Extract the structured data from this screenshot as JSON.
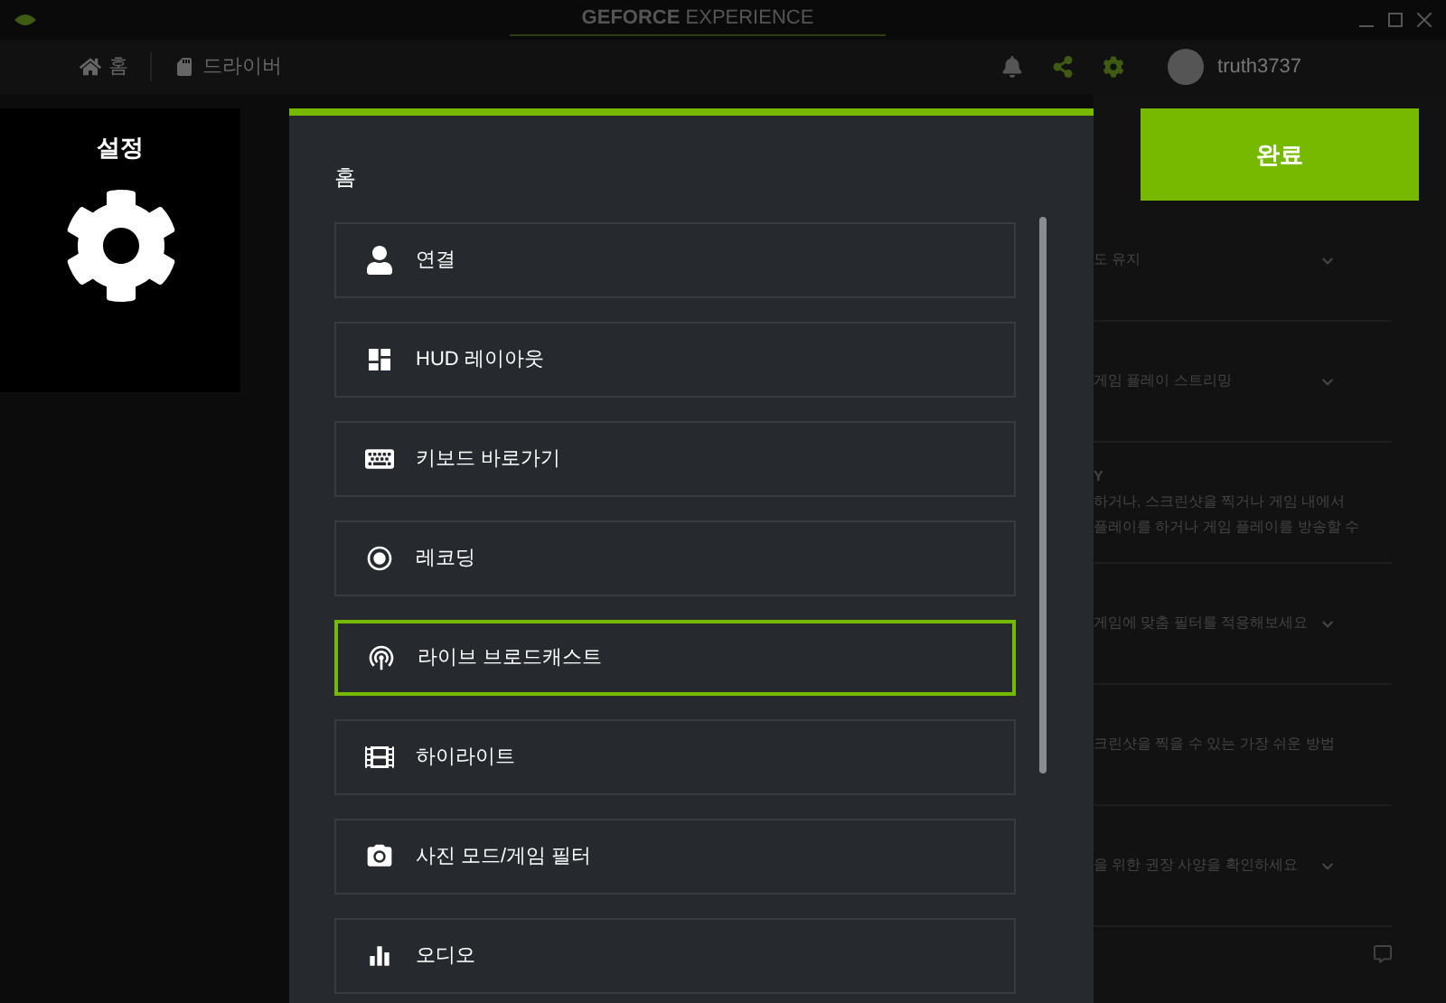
{
  "window": {
    "title_bold": "GEFORCE",
    "title_light": "EXPERIENCE"
  },
  "nav": [
    {
      "label": "홈",
      "kind": "home"
    },
    {
      "label": "드라이버",
      "kind": "driver"
    }
  ],
  "user": {
    "name": "truth3737"
  },
  "settings_tile": {
    "label": "설정"
  },
  "done_button": {
    "label": "완료"
  },
  "panel": {
    "heading": "홈",
    "items": [
      {
        "label": "연결",
        "kind": "person",
        "selected": false
      },
      {
        "label": "HUD 레이아웃",
        "kind": "layout",
        "selected": false
      },
      {
        "label": "키보드 바로가기",
        "kind": "keyboard",
        "selected": false
      },
      {
        "label": "레코딩",
        "kind": "record",
        "selected": false
      },
      {
        "label": "라이브 브로드캐스트",
        "kind": "broadcast",
        "selected": true
      },
      {
        "label": "하이라이트",
        "kind": "clapper",
        "selected": false
      },
      {
        "label": "사진 모드/게임 필터",
        "kind": "photo",
        "selected": false
      },
      {
        "label": "오디오",
        "kind": "audio",
        "selected": false
      }
    ]
  },
  "background_cards": [
    {
      "lines": [
        "도 유지"
      ]
    },
    {
      "lines": [
        "게임 플레이 스트리밍"
      ]
    },
    {
      "title": "Y",
      "lines": [
        "하거나, 스크린샷을 찍거나 게임 내에서",
        "플레이를 하거나 게임 플레이를 방송할 수"
      ]
    },
    {
      "lines": [
        "게임에 맞춤 필터를 적용해보세요"
      ]
    },
    {
      "lines": [
        "크린샷을 찍을 수 있는 가장 쉬운 방법"
      ]
    },
    {
      "lines": [
        "을 위한 권장 사양을 확인하세요"
      ]
    }
  ]
}
